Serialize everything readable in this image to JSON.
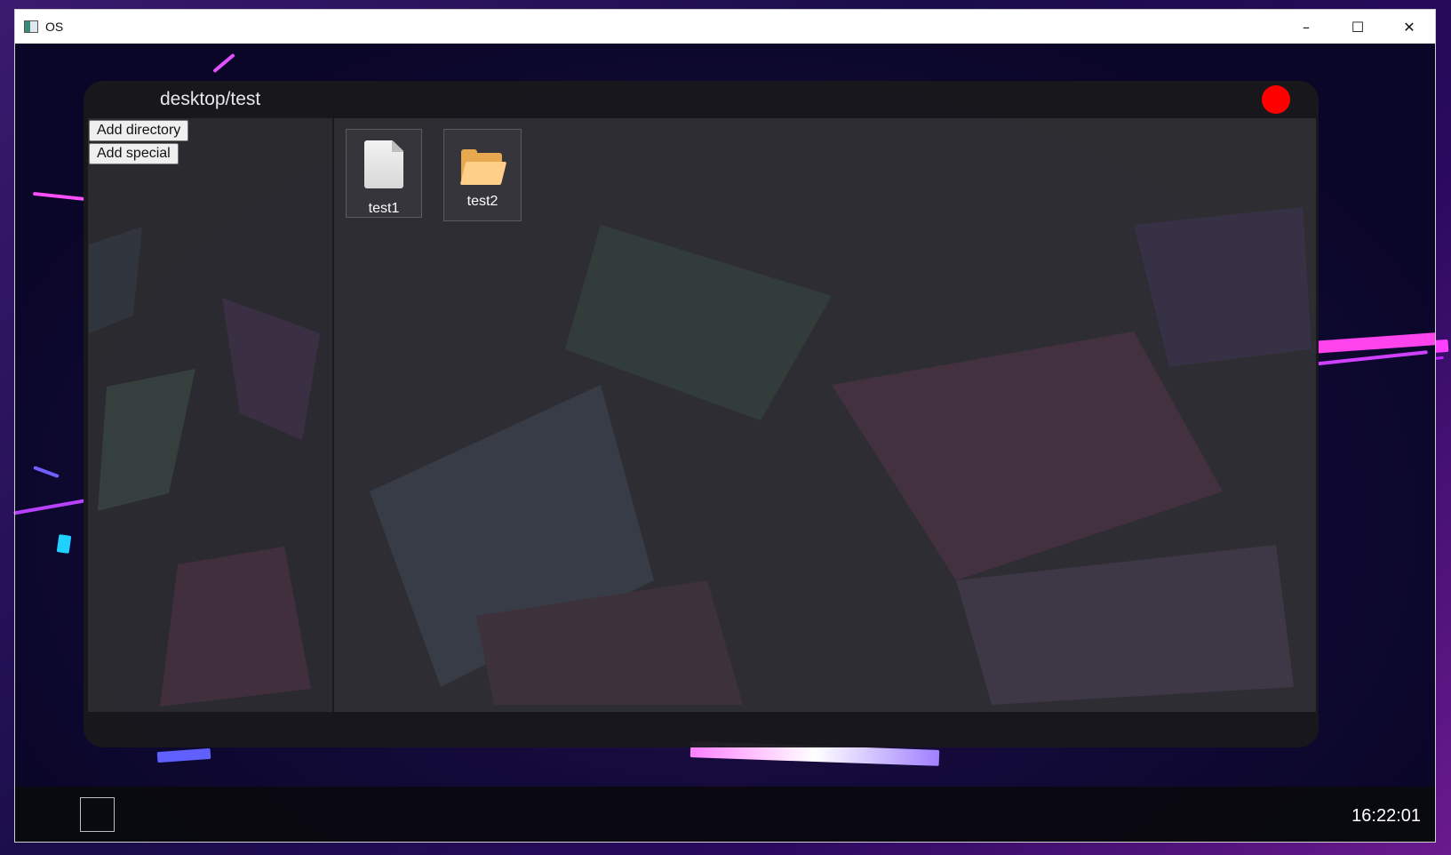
{
  "host": {
    "title": "OS",
    "controls": {
      "minimize": "–",
      "maximize": "☐",
      "close": "✕"
    }
  },
  "explorer": {
    "path": "desktop/test",
    "close_color": "#ff0000",
    "sidebar": {
      "add_directory": "Add directory",
      "add_special": "Add special"
    },
    "items": [
      {
        "label": "test1",
        "icon": "file-icon"
      },
      {
        "label": "test2",
        "icon": "folder-icon"
      }
    ]
  },
  "taskbar": {
    "clock": "16:22:01"
  }
}
